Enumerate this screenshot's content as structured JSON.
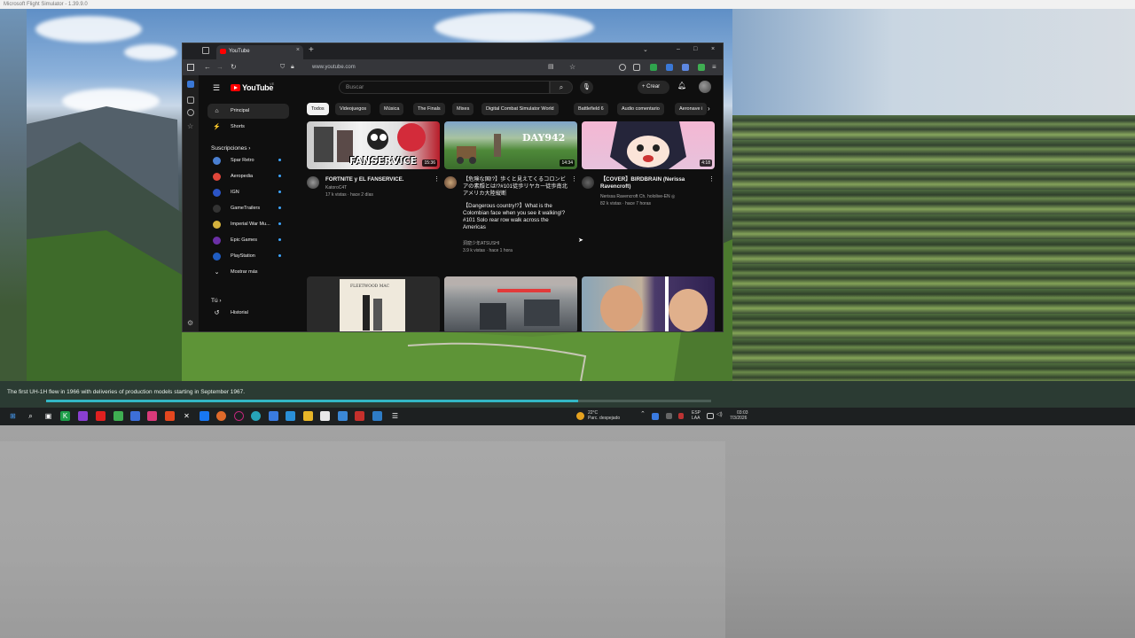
{
  "outer_window": {
    "title": "Microsoft Flight Simulator - 1.39.9.0",
    "caption": "The first UH-1H flew in 1966 with deliveries of production models starting in September 1967.",
    "caption_progress": 0.8
  },
  "browser": {
    "tab_title": "YouTube",
    "url": "www.youtube.com",
    "new_tab": "+",
    "close_tab": "×",
    "window_controls": {
      "dropdown": "⌄",
      "minimize": "–",
      "maximize": "□",
      "close": "×"
    }
  },
  "youtube": {
    "logo_text": "YouTube",
    "logo_cc": "VE",
    "search_placeholder": "Buscar",
    "create_label": "+ Crear",
    "nav": [
      {
        "label": "Principal",
        "icon": "home-icon",
        "glyph": "⌂",
        "active": true
      },
      {
        "label": "Shorts",
        "icon": "shorts-icon",
        "glyph": "⚡",
        "active": false
      }
    ],
    "subscriptions_title": "Suscripciones  ›",
    "subscriptions": [
      {
        "label": "Spar Retro",
        "color": "#4a7fd1"
      },
      {
        "label": "Aeropedia",
        "color": "#e0463a"
      },
      {
        "label": "IGN",
        "color": "#2b54c6"
      },
      {
        "label": "GameTrailers",
        "color": "#333333"
      },
      {
        "label": "Imperial War Mu...",
        "color": "#d4b13c"
      },
      {
        "label": "Epic Games",
        "color": "#6b2fa6"
      },
      {
        "label": "PlayStation",
        "color": "#1f5cc2"
      }
    ],
    "show_more": "Mostrar más",
    "you_section": "Tú  ›",
    "history": "Historial",
    "chips": [
      "Todos",
      "Videojuegos",
      "Música",
      "The Finals",
      "Mixes",
      "Digital Combat Simulator World",
      "Battlefield 6",
      "Audio comentario",
      "Aeronave i"
    ],
    "videos": [
      {
        "title": "FORTNITE y EL FANSERVICE.",
        "channel": "KatoroC4T",
        "stats": "17 k vistas · hace 2 días",
        "duration": "15:36",
        "thumb_text": "FANSERVICE"
      },
      {
        "title": "【危険な国!?】歩くと見えてくるコロンビアの素顔とは!?#101徒歩リヤカー徒歩南北アメリカ大陸縦断",
        "title2": "【Dangerous country!?】What is the Colombian face when you see it walking!? #101 Solo rear row walk across the Americas",
        "channel": "洞窟少年ATSUSHI",
        "stats": "3.9 k vistas · hace 1 hora",
        "duration": "14:34",
        "thumb_text": "DAY942"
      },
      {
        "title": "【COVER】BIRDBRAIN (Nerissa Ravencroft)",
        "channel": "Nerissa Ravencroft Ch. hololive-EN ◎",
        "stats": "82 k vistas · hace 7 horas",
        "duration": "4:18",
        "thumb_text": ""
      }
    ],
    "row2_thumb_text": [
      "FLEETWOOD MAC",
      "",
      ""
    ]
  },
  "taskbar": {
    "weather_temp": "22°C",
    "weather_desc": "Parc. despejado",
    "lang_top": "ESP",
    "lang_bottom": "LAA",
    "time": "03:03",
    "date": "7/3/2026"
  }
}
